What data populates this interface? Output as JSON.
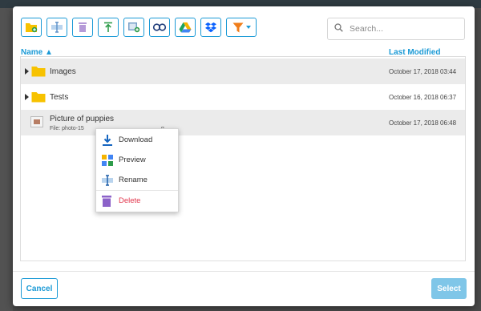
{
  "toolbar": {
    "buttons": [
      {
        "icon": "new-folder-icon"
      },
      {
        "icon": "rename-icon"
      },
      {
        "icon": "trash-icon"
      },
      {
        "icon": "upload-icon"
      },
      {
        "icon": "add-image-icon"
      },
      {
        "icon": "link-icon"
      },
      {
        "icon": "google-drive-icon"
      },
      {
        "icon": "dropbox-icon"
      },
      {
        "icon": "filter-icon"
      }
    ]
  },
  "search": {
    "placeholder": "Search..."
  },
  "columns": {
    "name": "Name ▲",
    "last_modified": "Last Modified"
  },
  "rows": [
    {
      "type": "folder",
      "name": "Images",
      "modified": "October 17, 2018 03:44"
    },
    {
      "type": "folder",
      "name": "Tests",
      "modified": "October 16, 2018 06:37"
    },
    {
      "type": "file",
      "name": "Picture of puppies",
      "meta_prefix": "File: photo-15",
      "meta_suffix": "g",
      "modified": "October 17, 2018 06:48"
    }
  ],
  "context_menu": {
    "items": [
      {
        "label": "Download",
        "icon": "download-icon"
      },
      {
        "label": "Preview",
        "icon": "preview-icon"
      },
      {
        "label": "Rename",
        "icon": "rename-icon"
      },
      {
        "label": "Delete",
        "icon": "trash-icon"
      }
    ]
  },
  "footer": {
    "cancel_label": "Cancel",
    "select_label": "Select"
  },
  "colors": {
    "accent": "#1b9ad6",
    "delete": "#e2384e",
    "folder": "#f7c200",
    "select_disabled": "#7fc6e8"
  }
}
